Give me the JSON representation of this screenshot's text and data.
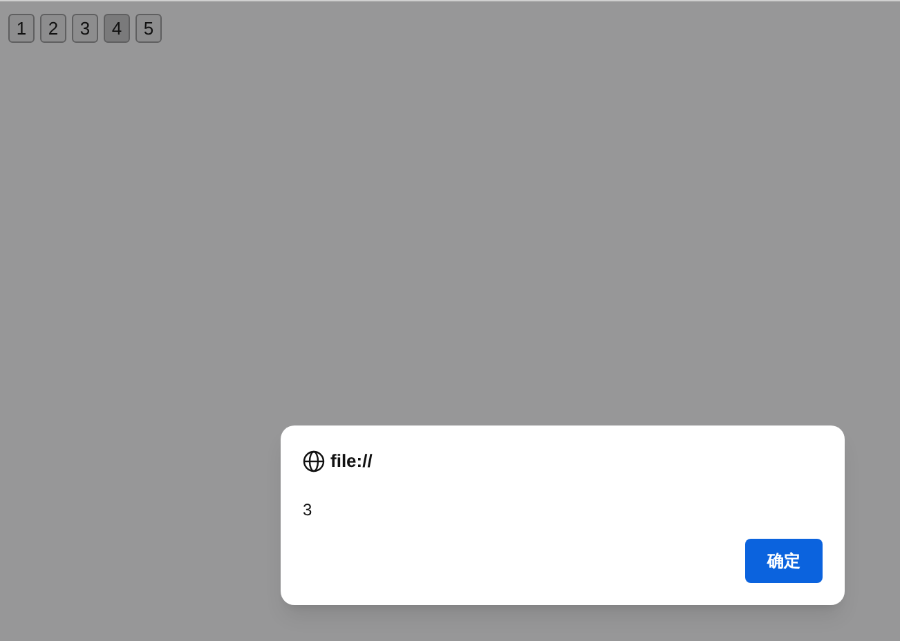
{
  "buttons": [
    {
      "label": "1",
      "selected": false
    },
    {
      "label": "2",
      "selected": false
    },
    {
      "label": "3",
      "selected": false
    },
    {
      "label": "4",
      "selected": true
    },
    {
      "label": "5",
      "selected": false
    }
  ],
  "dialog": {
    "title": "file://",
    "message": "3",
    "button": "确定"
  }
}
